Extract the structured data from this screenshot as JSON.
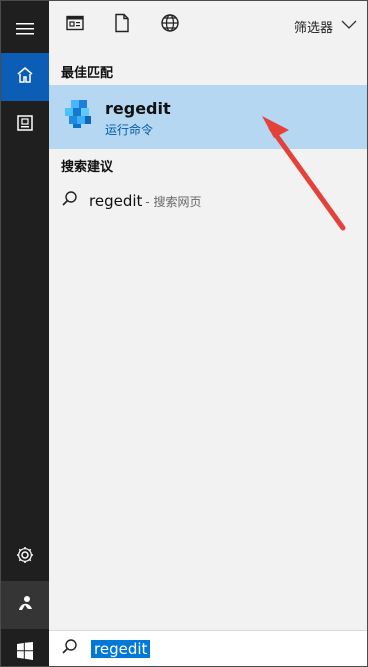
{
  "toolbar": {
    "filter_label": "筛选器"
  },
  "sections": {
    "best_match": "最佳匹配",
    "search_suggestions": "搜索建议"
  },
  "best_result": {
    "title": "regedit",
    "subtitle": "运行命令"
  },
  "suggestion": {
    "query": "regedit",
    "suffix": "- 搜索网页"
  },
  "search": {
    "value": "regedit"
  },
  "icons": {
    "menu": "hamburger-icon",
    "home": "home-icon",
    "documents": "document-icon",
    "settings": "gear-icon",
    "user": "person-icon",
    "windows": "windows-logo-icon",
    "apps": "app-window-icon",
    "file": "file-icon",
    "web": "globe-icon",
    "search": "search-icon",
    "registry": "registry-cube-icon",
    "arrow": "red-arrow-icon"
  },
  "colors": {
    "rail_bg": "#1f1f1f",
    "active_blue": "#0b5db5",
    "selected_row": "#b6d7f2",
    "link_blue": "#005ea8",
    "selection_blue": "#0078d7",
    "arrow_red": "#e3413a"
  }
}
